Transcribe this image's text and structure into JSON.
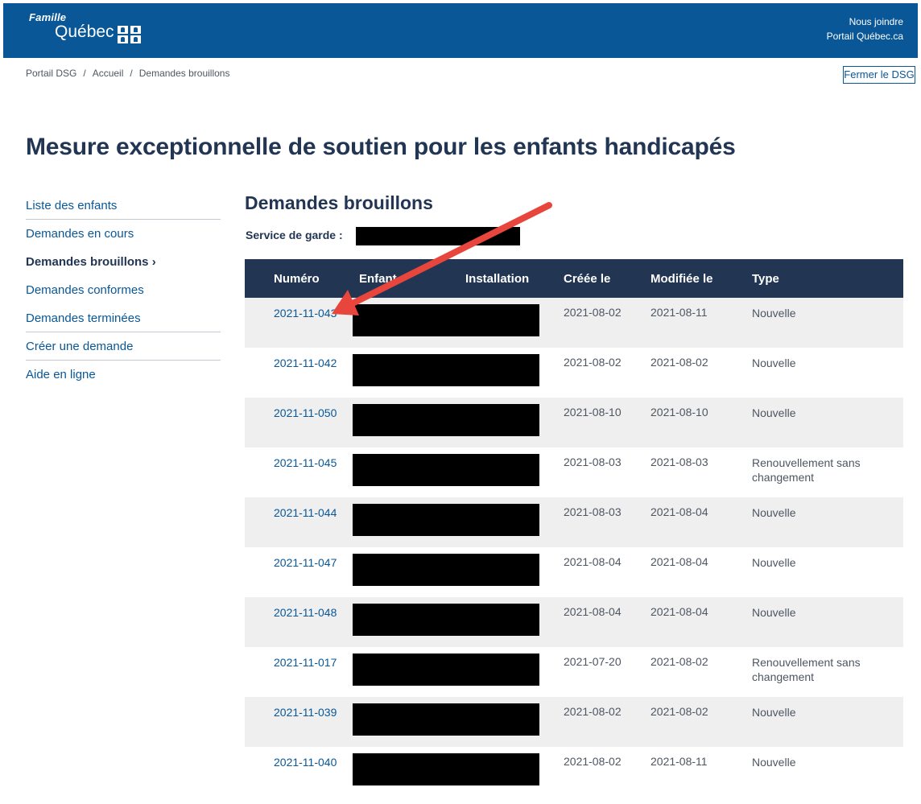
{
  "header": {
    "brand_small": "Famille",
    "brand_large": "Québec",
    "links": [
      "Nous joindre",
      "Portail Québec.ca"
    ]
  },
  "breadcrumb": [
    "Portail DSG",
    "Accueil",
    "Demandes brouillons"
  ],
  "close_button": "Fermer le DSG",
  "page_title": "Mesure exceptionnelle de soutien pour les enfants handicapés",
  "sidebar": {
    "items": [
      {
        "label": "Liste des enfants"
      },
      {
        "label": "Demandes en cours"
      },
      {
        "label": "Demandes brouillons ›"
      },
      {
        "label": "Demandes conformes"
      },
      {
        "label": "Demandes terminées"
      },
      {
        "label": "Créer une demande"
      },
      {
        "label": "Aide en ligne"
      }
    ]
  },
  "main": {
    "title": "Demandes brouillons",
    "service_label": "Service de garde :",
    "columns": [
      "Numéro",
      "Enfant",
      "Installation",
      "Créée le",
      "Modifiée le",
      "Type"
    ],
    "rows": [
      {
        "numero": "2021-11-043",
        "creee": "2021-08-02",
        "modifiee": "2021-08-11",
        "type": "Nouvelle"
      },
      {
        "numero": "2021-11-042",
        "creee": "2021-08-02",
        "modifiee": "2021-08-02",
        "type": "Nouvelle"
      },
      {
        "numero": "2021-11-050",
        "creee": "2021-08-10",
        "modifiee": "2021-08-10",
        "type": "Nouvelle"
      },
      {
        "numero": "2021-11-045",
        "creee": "2021-08-03",
        "modifiee": "2021-08-03",
        "type": "Renouvellement sans changement"
      },
      {
        "numero": "2021-11-044",
        "creee": "2021-08-03",
        "modifiee": "2021-08-04",
        "type": "Nouvelle"
      },
      {
        "numero": "2021-11-047",
        "creee": "2021-08-04",
        "modifiee": "2021-08-04",
        "type": "Nouvelle"
      },
      {
        "numero": "2021-11-048",
        "creee": "2021-08-04",
        "modifiee": "2021-08-04",
        "type": "Nouvelle"
      },
      {
        "numero": "2021-11-017",
        "creee": "2021-07-20",
        "modifiee": "2021-08-02",
        "type": "Renouvellement sans changement"
      },
      {
        "numero": "2021-11-039",
        "creee": "2021-08-02",
        "modifiee": "2021-08-02",
        "type": "Nouvelle"
      },
      {
        "numero": "2021-11-040",
        "creee": "2021-08-02",
        "modifiee": "2021-08-11",
        "type": "Nouvelle"
      }
    ]
  },
  "colors": {
    "brand_blue": "#095797",
    "dark_navy": "#223654",
    "annotation_arrow": "#e8453c"
  }
}
